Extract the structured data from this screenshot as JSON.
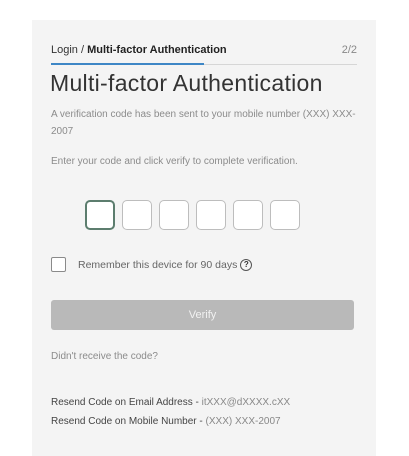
{
  "breadcrumb": {
    "login": "Login",
    "separator": "/",
    "current": "Multi-factor Authentication",
    "page_count": "2/2",
    "progress": 0.5
  },
  "title": "Multi-factor Authentication",
  "sent_message": "A verification code has been sent to your mobile number (XXX) XXX-2007",
  "instructions": "Enter your code and click verify to complete verification.",
  "code_inputs": [
    "",
    "",
    "",
    "",
    "",
    ""
  ],
  "remember": {
    "label": "Remember this device for 90 days",
    "checked": false,
    "help_icon": "question-circle-icon"
  },
  "verify_label": "Verify",
  "no_code_text": "Didn't receive the code?",
  "resend": {
    "email_label": "Resend Code on Email Address - ",
    "email_value": "itXXX@dXXXX.cXX",
    "mobile_label": "Resend Code on Mobile Number - ",
    "mobile_value": "(XXX) XXX-2007"
  },
  "colors": {
    "progress": "#3e87c6",
    "verify_disabled": "#b9b9b9",
    "active_input_border": "#5c7d6e"
  }
}
